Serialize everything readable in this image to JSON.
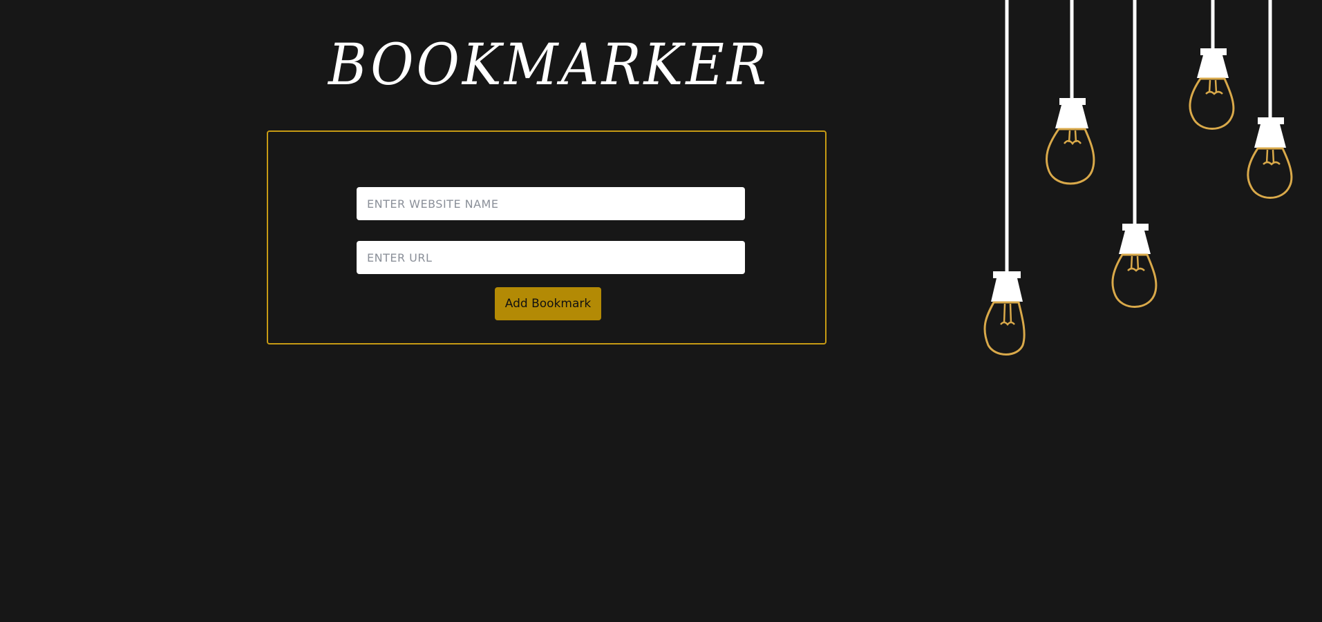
{
  "app": {
    "title": "BOOKMARKER"
  },
  "form": {
    "website_name_placeholder": "ENTER WEBSITE NAME",
    "url_placeholder": "ENTER URL",
    "submit_label": "Add Bookmark"
  },
  "colors": {
    "background": "#171717",
    "accent": "#b38a05",
    "border": "#c79b14",
    "bulb_outline": "#d9a94a",
    "text": "#ffffff"
  }
}
